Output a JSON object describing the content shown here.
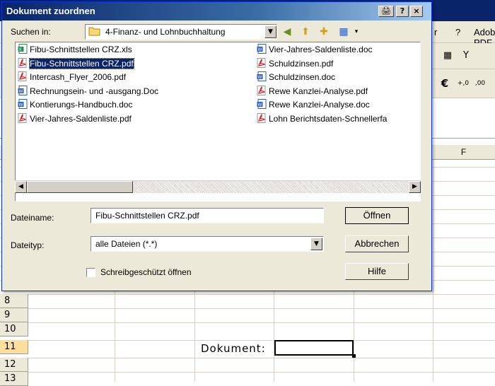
{
  "excel": {
    "menu": {
      "item_r": "r",
      "help_label": "?",
      "adobe_label": "Adobe PDF"
    },
    "columns": [
      "F"
    ],
    "rows": [
      "8",
      "9",
      "10",
      "11",
      "12",
      "13"
    ],
    "cell_label": "Dokument:"
  },
  "dialog": {
    "title": "Dokument zuordnen",
    "title_buttons": [
      "🖨",
      "?",
      "×"
    ],
    "look_in_label": "Suchen in:",
    "look_in_value": "4-Finanz- und Lohnbuchhaltung",
    "files_col1": [
      {
        "name": "Fibu-Schnittstellen CRZ.xls",
        "type": "xls",
        "selected": false
      },
      {
        "name": "Fibu-Schnittstellen CRZ.pdf",
        "type": "pdf",
        "selected": true
      },
      {
        "name": "Intercash_Flyer_2006.pdf",
        "type": "pdf",
        "selected": false
      },
      {
        "name": "Rechnungsein- und -ausgang.Doc",
        "type": "doc",
        "selected": false
      },
      {
        "name": "Kontierungs-Handbuch.doc",
        "type": "doc",
        "selected": false
      },
      {
        "name": "Vier-Jahres-Saldenliste.pdf",
        "type": "pdf",
        "selected": false
      }
    ],
    "files_col2": [
      {
        "name": "Vier-Jahres-Saldenliste.doc",
        "type": "doc",
        "selected": false
      },
      {
        "name": "Schuldzinsen.pdf",
        "type": "pdf",
        "selected": false
      },
      {
        "name": "Schuldzinsen.doc",
        "type": "doc",
        "selected": false
      },
      {
        "name": "Rewe Kanzlei-Analyse.pdf",
        "type": "pdf",
        "selected": false
      },
      {
        "name": "Rewe Kanzlei-Analyse.doc",
        "type": "doc",
        "selected": false
      },
      {
        "name": "Lohn Berichtsdaten-Schnellerfa",
        "type": "pdf",
        "selected": false
      }
    ],
    "filename_label": "Dateiname:",
    "filename_value": "Fibu-Schnittstellen CRZ.pdf",
    "filetype_label": "Dateityp:",
    "filetype_value": "alle Dateien (*.*)",
    "readonly_label": "Schreibgeschützt öffnen",
    "open_button": "Öffnen",
    "cancel_button": "Abbrechen",
    "help_button": "Hilfe"
  }
}
